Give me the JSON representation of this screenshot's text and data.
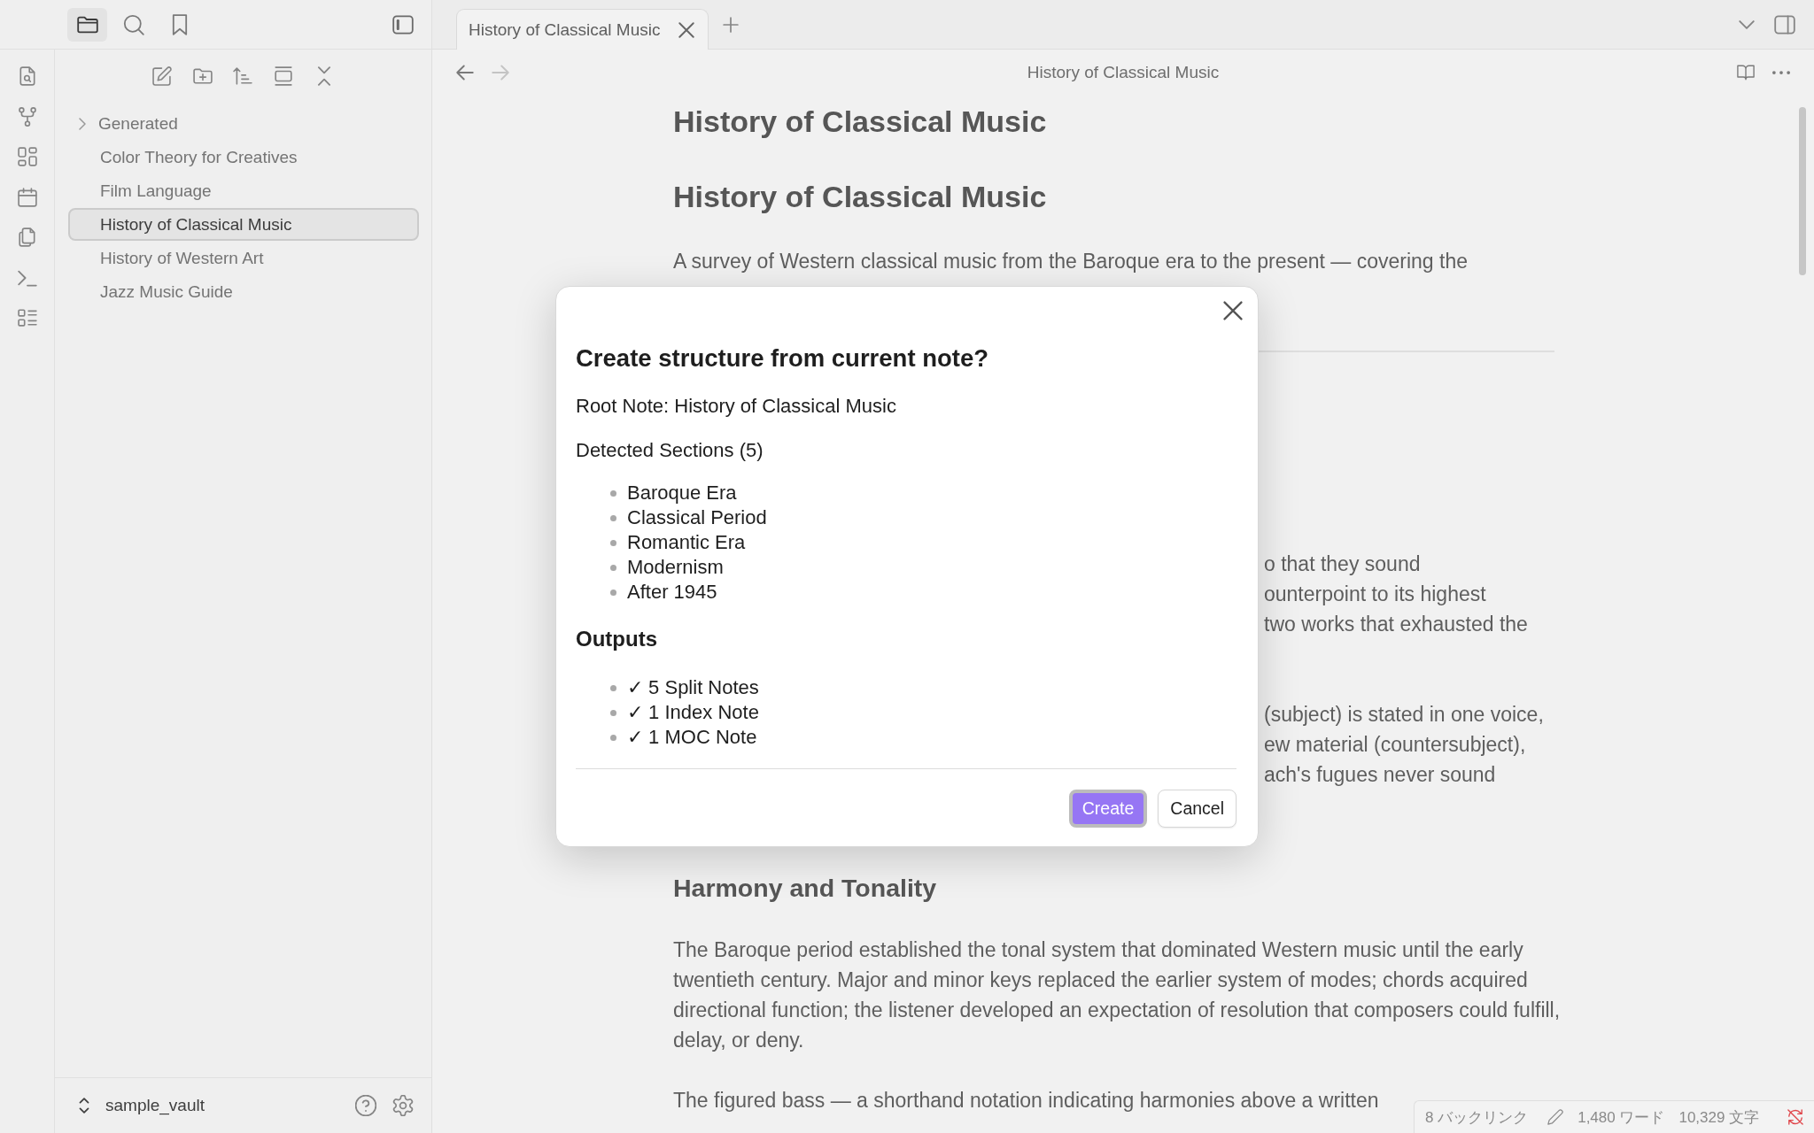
{
  "left_tabs": [
    {
      "kind": "files",
      "selected": true
    },
    {
      "kind": "search",
      "selected": false
    },
    {
      "kind": "bookmarks",
      "selected": false
    }
  ],
  "file_tree": [
    {
      "kind": "folder",
      "name": "Generated",
      "expanded": false,
      "selected": false
    },
    {
      "kind": "file",
      "name": "Color Theory for Creatives",
      "selected": false
    },
    {
      "kind": "file",
      "name": "Film Language",
      "selected": false
    },
    {
      "kind": "file",
      "name": "History of Classical Music",
      "selected": true
    },
    {
      "kind": "file",
      "name": "History of Western Art",
      "selected": false
    },
    {
      "kind": "file",
      "name": "Jazz Music Guide",
      "selected": false
    }
  ],
  "vault": {
    "name": "sample_vault"
  },
  "tabs": [
    {
      "title": "History of Classical Music",
      "selected": true
    }
  ],
  "nav": {
    "title": "History of Classical Music",
    "buttons": [
      {
        "kind": "back",
        "disabled": false
      },
      {
        "kind": "forward",
        "disabled": true
      }
    ]
  },
  "document": {
    "blocks": [
      {
        "kind": "title",
        "text": "History of Classical Music"
      },
      {
        "kind": "h1",
        "text": "History of Classical Music"
      },
      {
        "kind": "p",
        "text": "A survey of Western classical music from the Baroque era to the present — covering the"
      },
      {
        "kind": "hr"
      },
      {
        "kind": "covered",
        "lines": [
          "o that they sound",
          "ounterpoint to its highest",
          "two works that exhausted the"
        ]
      },
      {
        "kind": "covered",
        "lines": [
          "(subject) is stated in one voice,",
          "ew material (countersubject),",
          "ach's fugues never sound"
        ]
      },
      {
        "kind": "h2",
        "text": "Harmony and Tonality"
      },
      {
        "kind": "p",
        "text": "The Baroque period established the tonal system that dominated Western music until the early twentieth century. Major and minor keys replaced the earlier system of modes; chords acquired directional function; the listener developed an expectation of resolution that composers could fulfill, delay, or deny."
      },
      {
        "kind": "p",
        "text": "The figured bass — a shorthand notation indicating harmonies above a written"
      }
    ]
  },
  "dialog": {
    "title": "Create structure from current note?",
    "root_note": "Root Note: History of Classical Music",
    "sections_label": "Detected Sections (5)",
    "sections": [
      "Baroque Era",
      "Classical Period",
      "Romantic Era",
      "Modernism",
      "After 1945"
    ],
    "outputs_heading": "Outputs",
    "outputs": [
      "✓ 5 Split Notes",
      "✓ 1 Index Note",
      "✓ 1 MOC Note"
    ],
    "buttons": [
      {
        "label": "Create",
        "kind": "primary",
        "focused": true
      },
      {
        "label": "Cancel",
        "kind": "secondary",
        "focused": false
      }
    ]
  },
  "status_bar": {
    "backlinks": "8 バックリンク",
    "words": "1,480 ワード",
    "characters": "10,329 文字"
  }
}
